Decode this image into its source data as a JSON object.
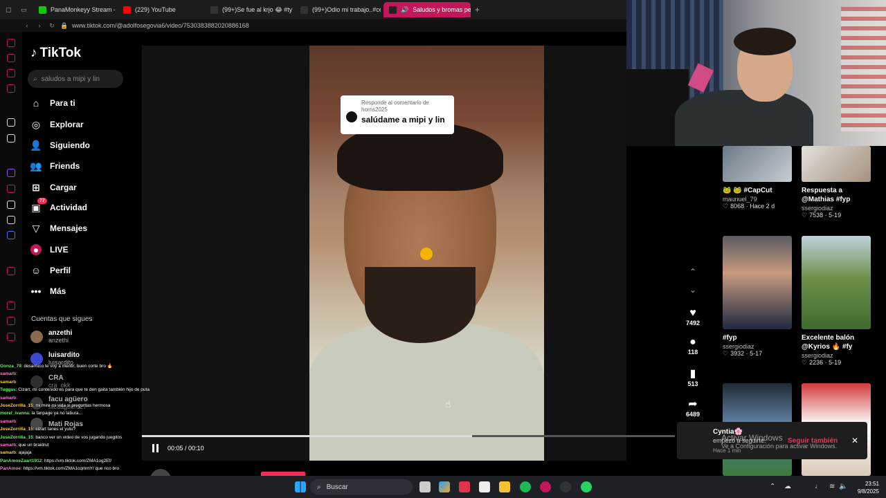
{
  "browser": {
    "tabs": [
      {
        "label": "PanaMonkeyy Stream - V",
        "color": "#16c60c"
      },
      {
        "label": "(229) YouTube",
        "color": "#ff0000"
      },
      {
        "label": "(99+)Se fue al krjo 😂 #ty",
        "color": "#111111"
      },
      {
        "label": "(99+)Odio mi trabajo..#ce",
        "color": "#111111"
      },
      {
        "label": "Saludos y bromas pe",
        "color": "#ffffff"
      }
    ],
    "url": "www.tiktok.com/@adolfosegovia6/video/7530383882020886168"
  },
  "sidebar": {
    "logo": "TikTok",
    "search_placeholder": "saludos a mipi y lin",
    "nav": [
      {
        "label": "Para ti",
        "icon": "home-icon"
      },
      {
        "label": "Explorar",
        "icon": "compass-icon"
      },
      {
        "label": "Siguiendo",
        "icon": "following-icon"
      },
      {
        "label": "Friends",
        "icon": "friends-icon"
      },
      {
        "label": "Cargar",
        "icon": "upload-icon"
      },
      {
        "label": "Actividad",
        "icon": "activity-icon",
        "badge": "77"
      },
      {
        "label": "Mensajes",
        "icon": "messages-icon"
      },
      {
        "label": "LIVE",
        "icon": "live-icon"
      },
      {
        "label": "Perfil",
        "icon": "profile-icon"
      },
      {
        "label": "Más",
        "icon": "more-icon"
      }
    ],
    "following_title": "Cuentas que sigues",
    "following": [
      {
        "name": "anzethi",
        "handle": "anzethi"
      },
      {
        "name": "luisardito",
        "handle": "luisardito"
      },
      {
        "name": "CRA",
        "handle": "cra_okk"
      },
      {
        "name": "facu agüero",
        "handle": "facuagüero27"
      },
      {
        "name": "Mati Rojas",
        "handle": ""
      }
    ]
  },
  "video": {
    "reply_to": "Responde al comentario de horns2025",
    "comment": "salúdame a mipi y lin",
    "time_current": "00:05",
    "time_total": "00:10",
    "progress": 0.62,
    "author": "adolfosegovia6"
  },
  "actions": {
    "likes": "7492",
    "comments": "118",
    "saves": "513",
    "shares": "6489"
  },
  "grid": [
    {
      "title": "🐸 🐸 #CapCut",
      "user": "maunuel_79",
      "stats": "8068 · Hace 2 d"
    },
    {
      "title": "Respuesta a @Mathias #fyp",
      "user": "ssergiodiaz",
      "stats": "7538 · 5-19"
    },
    {
      "title": "#fyp",
      "user": "ssergiodiaz",
      "stats": "3932 · 5-17"
    },
    {
      "title": "Excelente balón @Kyrios 🔥 #fy",
      "user": "ssergiodiaz",
      "stats": "2236 · 5-19"
    }
  ],
  "notification": {
    "name": "Cyntia🌸",
    "message": "empezó a seguirte.",
    "time": "Hace 1 min",
    "button": "Seguir también"
  },
  "watermark": {
    "line1": "Activar Windows",
    "line2": "Ve a Configuración para activar Windows."
  },
  "chat": [
    {
      "user": "Gonza_79",
      "msg": ": desarruco te voy a mentir, buen corte bro 🔥"
    },
    {
      "user": "samarb",
      "msg": ":"
    },
    {
      "user": "samarb",
      "msg": ":"
    },
    {
      "user": "Tuggas",
      "msg": ": Cizart, mi contenido es para que te den gaita también hijo de puta"
    },
    {
      "user": "samarb",
      "msg": ":"
    },
    {
      "user": "JoseZorrilla_15",
      "msg": ": mi mire mi vida si preguntas hermosa"
    },
    {
      "user": "morel_ivanna",
      "msg": ": la fanpage ya no labura..."
    },
    {
      "user": "samarb",
      "msg": ":"
    },
    {
      "user": "JoseZorrilla_15",
      "msg": ": cizart tanes el yutu?"
    },
    {
      "user": "JoseZorrilla_15",
      "msg": ": banco ver un video de vos jugando juegitos"
    },
    {
      "user": "samarb",
      "msg": ": que un braidrut"
    },
    {
      "user": "samarb",
      "msg": ": ajajaja"
    },
    {
      "user": "PanAmoeZaart1912",
      "msg": ": https://vm.tiktok.com/ZMA1og2Ef/"
    },
    {
      "user": "PanAmoe",
      "msg": ": https://vm.tiktok.com/ZMA1cqmmY/ que rico bro"
    }
  ],
  "taskbar": {
    "search": "Buscar",
    "time": "23:51",
    "date": "9/8/2025"
  }
}
